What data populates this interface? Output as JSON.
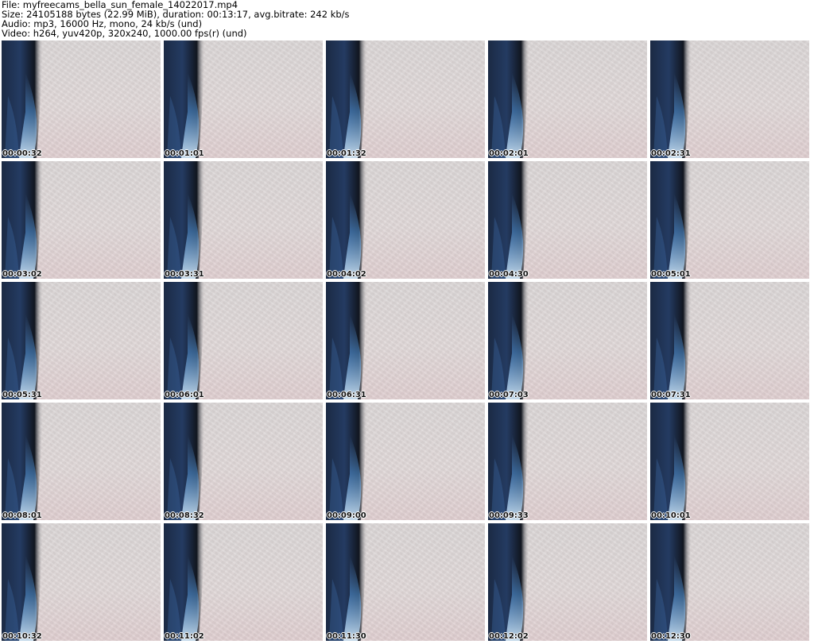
{
  "info": {
    "file": "File: myfreecams_bella_sun_female_14022017.mp4",
    "size": "Size: 24105188 bytes (22.99 MiB), duration: 00:13:17, avg.bitrate: 242 kb/s",
    "audio": "Audio: mp3, 16000 Hz, mono, 24 kb/s (und)",
    "video": "Video: h264, yuv420p, 320x240, 1000.00 fps(r) (und)"
  },
  "timestamps": [
    "00:00:32",
    "00:01:01",
    "00:01:32",
    "00:02:01",
    "00:02:31",
    "00:03:02",
    "00:03:31",
    "00:04:02",
    "00:04:30",
    "00:05:01",
    "00:05:31",
    "00:06:01",
    "00:06:31",
    "00:07:03",
    "00:07:31",
    "00:08:01",
    "00:08:32",
    "00:09:00",
    "00:09:33",
    "00:10:01",
    "00:10:32",
    "00:11:02",
    "00:11:30",
    "00:12:02",
    "00:12:30"
  ]
}
